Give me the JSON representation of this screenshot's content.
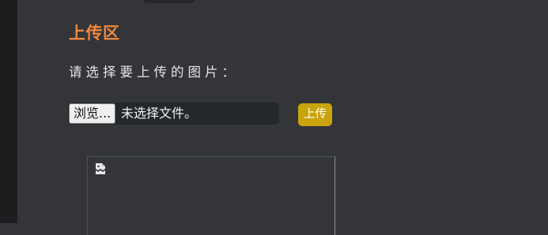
{
  "upload_section": {
    "title": "上传区",
    "prompt": "请选择要上传的图片：",
    "file_input": {
      "browse_label": "浏览...",
      "status": "未选择文件。"
    },
    "upload_button": "上传"
  },
  "preview": {
    "icon": "broken-image-icon"
  },
  "colors": {
    "background": "#333538",
    "title": "#f0883e",
    "upload_button": "#c9a40d"
  }
}
